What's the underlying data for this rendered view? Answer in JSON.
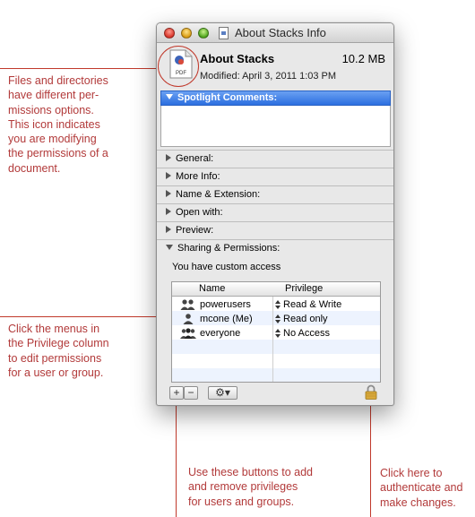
{
  "annotations": {
    "icon_note": [
      "Files and directories",
      "have different per-",
      "missions options.",
      "This icon indicates",
      "you are modifying",
      "the permissions of a",
      "document."
    ],
    "privilege_note": [
      "Click the menus in",
      "the Privilege column",
      "to edit permissions",
      "for a user or group."
    ],
    "buttons_note": [
      "Use these buttons to add",
      "and remove privileges",
      "for users and groups."
    ],
    "lock_note": [
      "Click here to",
      "authenticate and",
      "make changes."
    ]
  },
  "window": {
    "title": "About Stacks Info",
    "doc_name": "About Stacks",
    "doc_size": "10.2 MB",
    "modified": "Modified: April 3, 2011 1:03 PM",
    "file_badge": "PDF",
    "spotlight_label": "Spotlight Comments:",
    "sections": [
      "General:",
      "More Info:",
      "Name & Extension:",
      "Open with:",
      "Preview:"
    ],
    "sharing_label": "Sharing & Permissions:",
    "access_text": "You have custom access",
    "table": {
      "headers": {
        "name": "Name",
        "privilege": "Privilege"
      },
      "rows": [
        {
          "name": "powerusers",
          "privilege": "Read & Write",
          "icon": "group-icon"
        },
        {
          "name": "mcone (Me)",
          "privilege": "Read only",
          "icon": "user-icon"
        },
        {
          "name": "everyone",
          "privilege": "No Access",
          "icon": "everyone-icon"
        }
      ]
    },
    "buttons": {
      "add": "+",
      "remove": "−",
      "action": "⚙▾"
    }
  },
  "colors": {
    "annotation": "#b23a3a",
    "selection": "#2c6fe0",
    "stripe": "#edf3fe"
  }
}
